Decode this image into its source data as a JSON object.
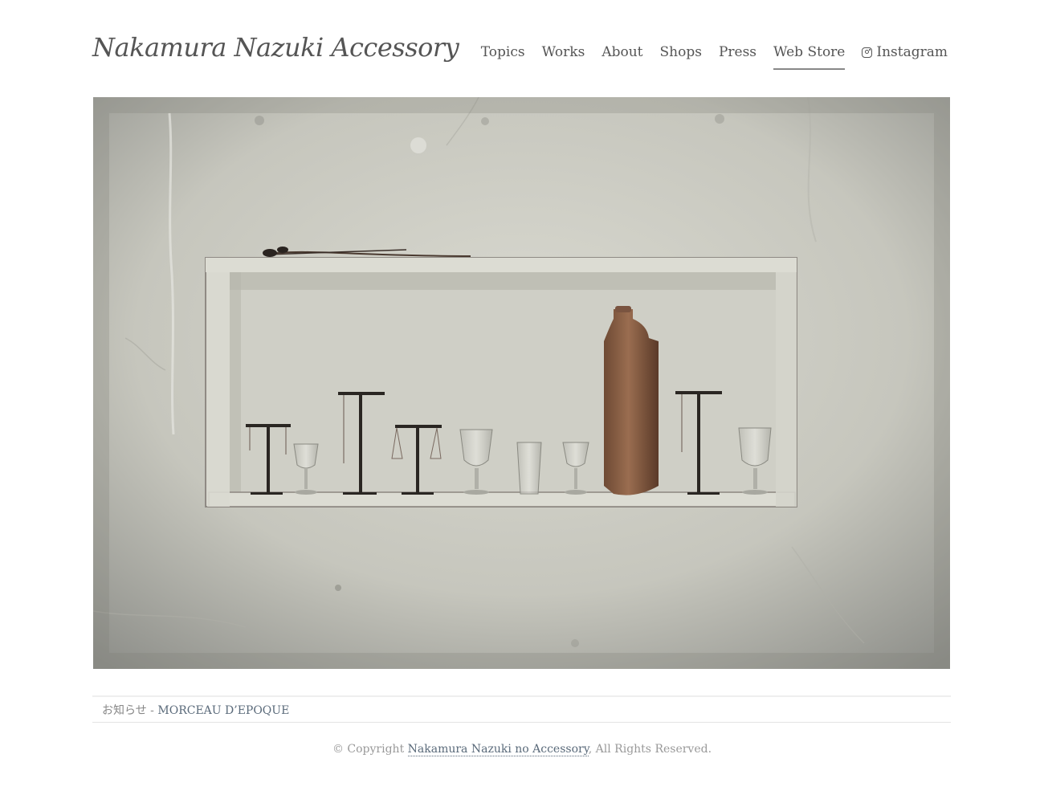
{
  "site": {
    "logo_text": "Nakamura Nazuki  Accessory"
  },
  "nav": {
    "items": [
      {
        "label": "Topics"
      },
      {
        "label": "Works"
      },
      {
        "label": "About"
      },
      {
        "label": "Shops"
      },
      {
        "label": "Press"
      },
      {
        "label": "Web Store",
        "active": true
      },
      {
        "label": "Instagram",
        "icon": "instagram-icon"
      }
    ]
  },
  "hero": {
    "icon": "photo-display-shelf-with-glasses-and-jewelry-stands"
  },
  "notice": {
    "label": "お知らせ",
    "separator": " - ",
    "link_text": "MORCEAU D’EPOQUE"
  },
  "footer": {
    "prefix": "© Copyright ",
    "link_text": "Nakamura Nazuki no Accessory",
    "suffix": ", All Rights Reserved."
  },
  "colors": {
    "text": "#555555",
    "link": "#5a6a7a",
    "muted": "#999999",
    "active_underline": "#888888"
  }
}
